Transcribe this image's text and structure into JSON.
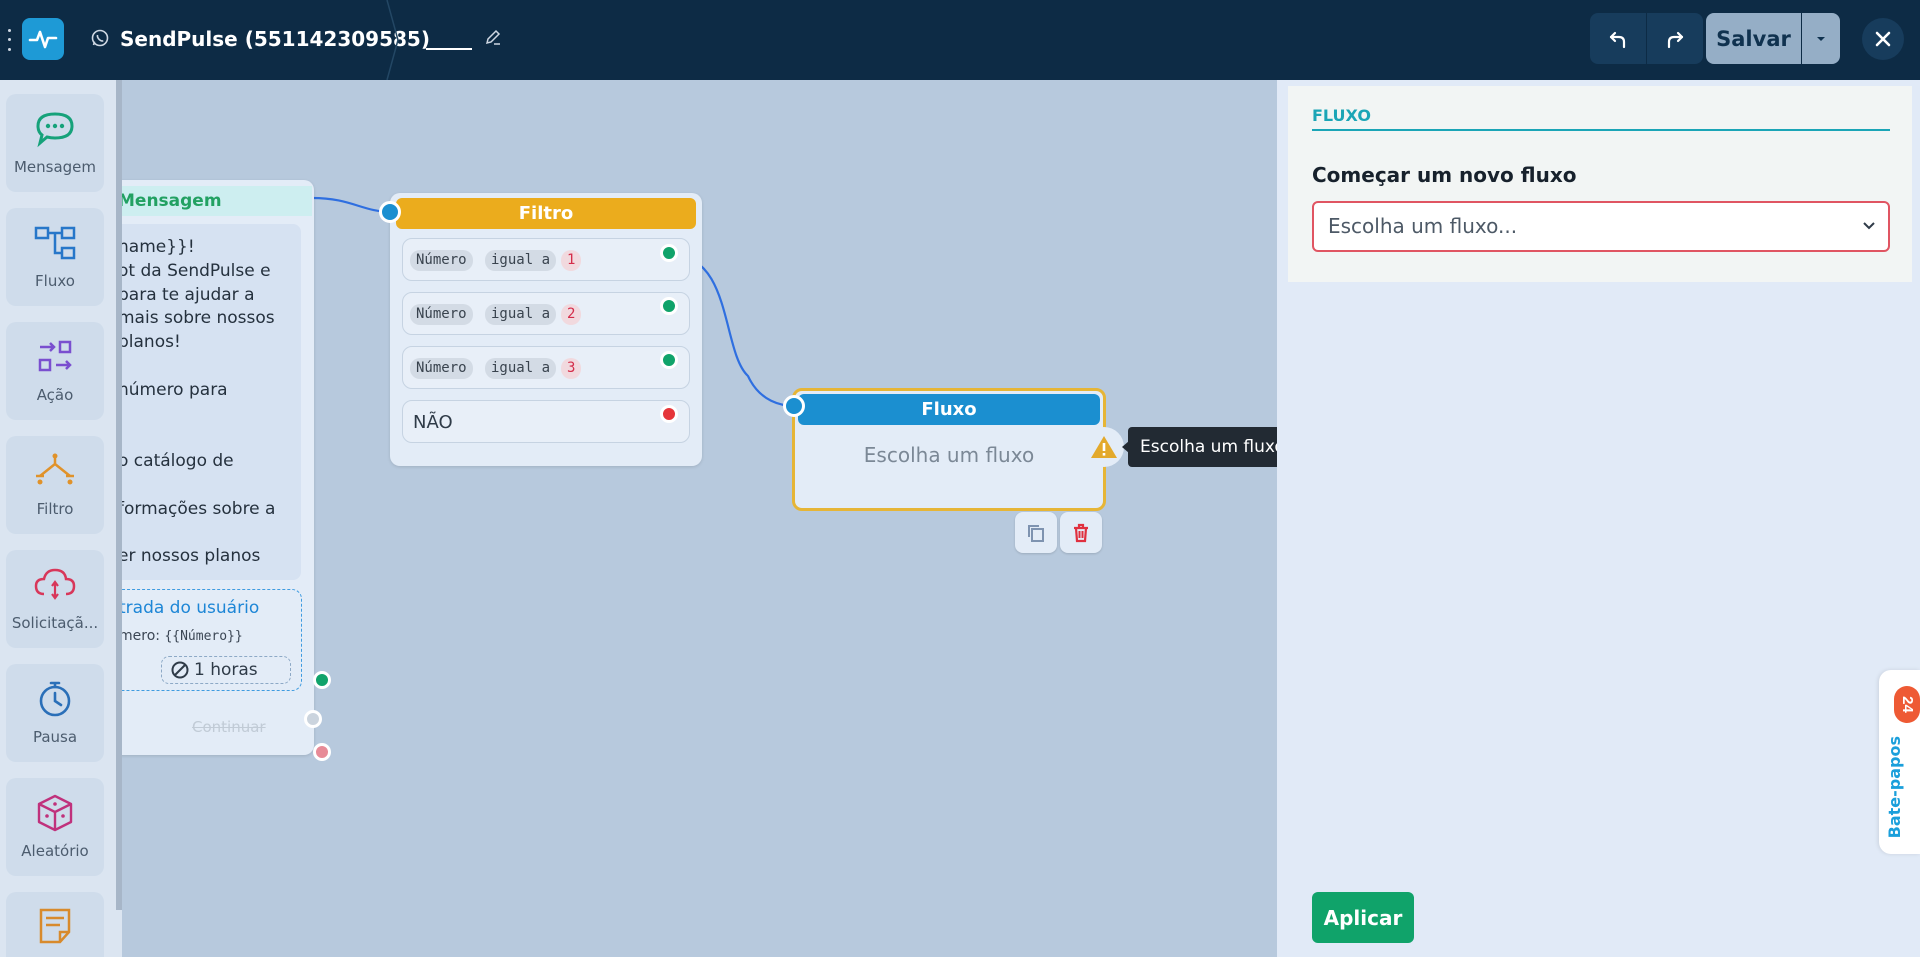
{
  "header": {
    "channel_name": "SendPulse (551142309585)",
    "save_label": "Salvar"
  },
  "palette": {
    "items": [
      {
        "label": "Mensagem",
        "icon": "chat-bubble-icon"
      },
      {
        "label": "Fluxo",
        "icon": "flow-icon"
      },
      {
        "label": "Ação",
        "icon": "action-icon"
      },
      {
        "label": "Filtro",
        "icon": "filter-icon"
      },
      {
        "label": "Solicitaçã...",
        "icon": "cloud-request-icon"
      },
      {
        "label": "Pausa",
        "icon": "timer-icon"
      },
      {
        "label": "Aleatório",
        "icon": "dice-icon"
      }
    ]
  },
  "message_node": {
    "title": "Mensagem",
    "body_lines": [
      "name}}!",
      "ot da SendPulse e",
      "para te ajudar a",
      "mais sobre nossos",
      "planos!",
      "",
      "número para",
      "",
      "",
      "o catálogo de",
      "",
      "formações sobre a",
      "",
      "er nossos planos"
    ],
    "user_input_title": "trada do usuário",
    "user_input_var_label": "mero:",
    "user_input_var": "{{Número}}",
    "timeout": "1 horas",
    "continue_label": "Continuar"
  },
  "filter_node": {
    "title": "Filtro",
    "conditions": [
      {
        "field": "Número",
        "op": "igual a",
        "value": "1"
      },
      {
        "field": "Número",
        "op": "igual a",
        "value": "2"
      },
      {
        "field": "Número",
        "op": "igual a",
        "value": "3"
      }
    ],
    "else_label": "NÃO"
  },
  "flow_node": {
    "title": "Fluxo",
    "placeholder": "Escolha um fluxo",
    "tooltip": "Escolha um fluxo"
  },
  "right_panel": {
    "section": "FLUXO",
    "label": "Começar um novo fluxo",
    "select_value": "Escolha um fluxo...",
    "apply_label": "Aplicar"
  },
  "chats_tab": {
    "label": "Bate-papos",
    "badge": "24"
  },
  "colors": {
    "topbar": "#0d2b45",
    "filter": "#ebac1d",
    "flow": "#1b8fd0",
    "green": "#10a36a",
    "accent": "#1ba5b6"
  }
}
